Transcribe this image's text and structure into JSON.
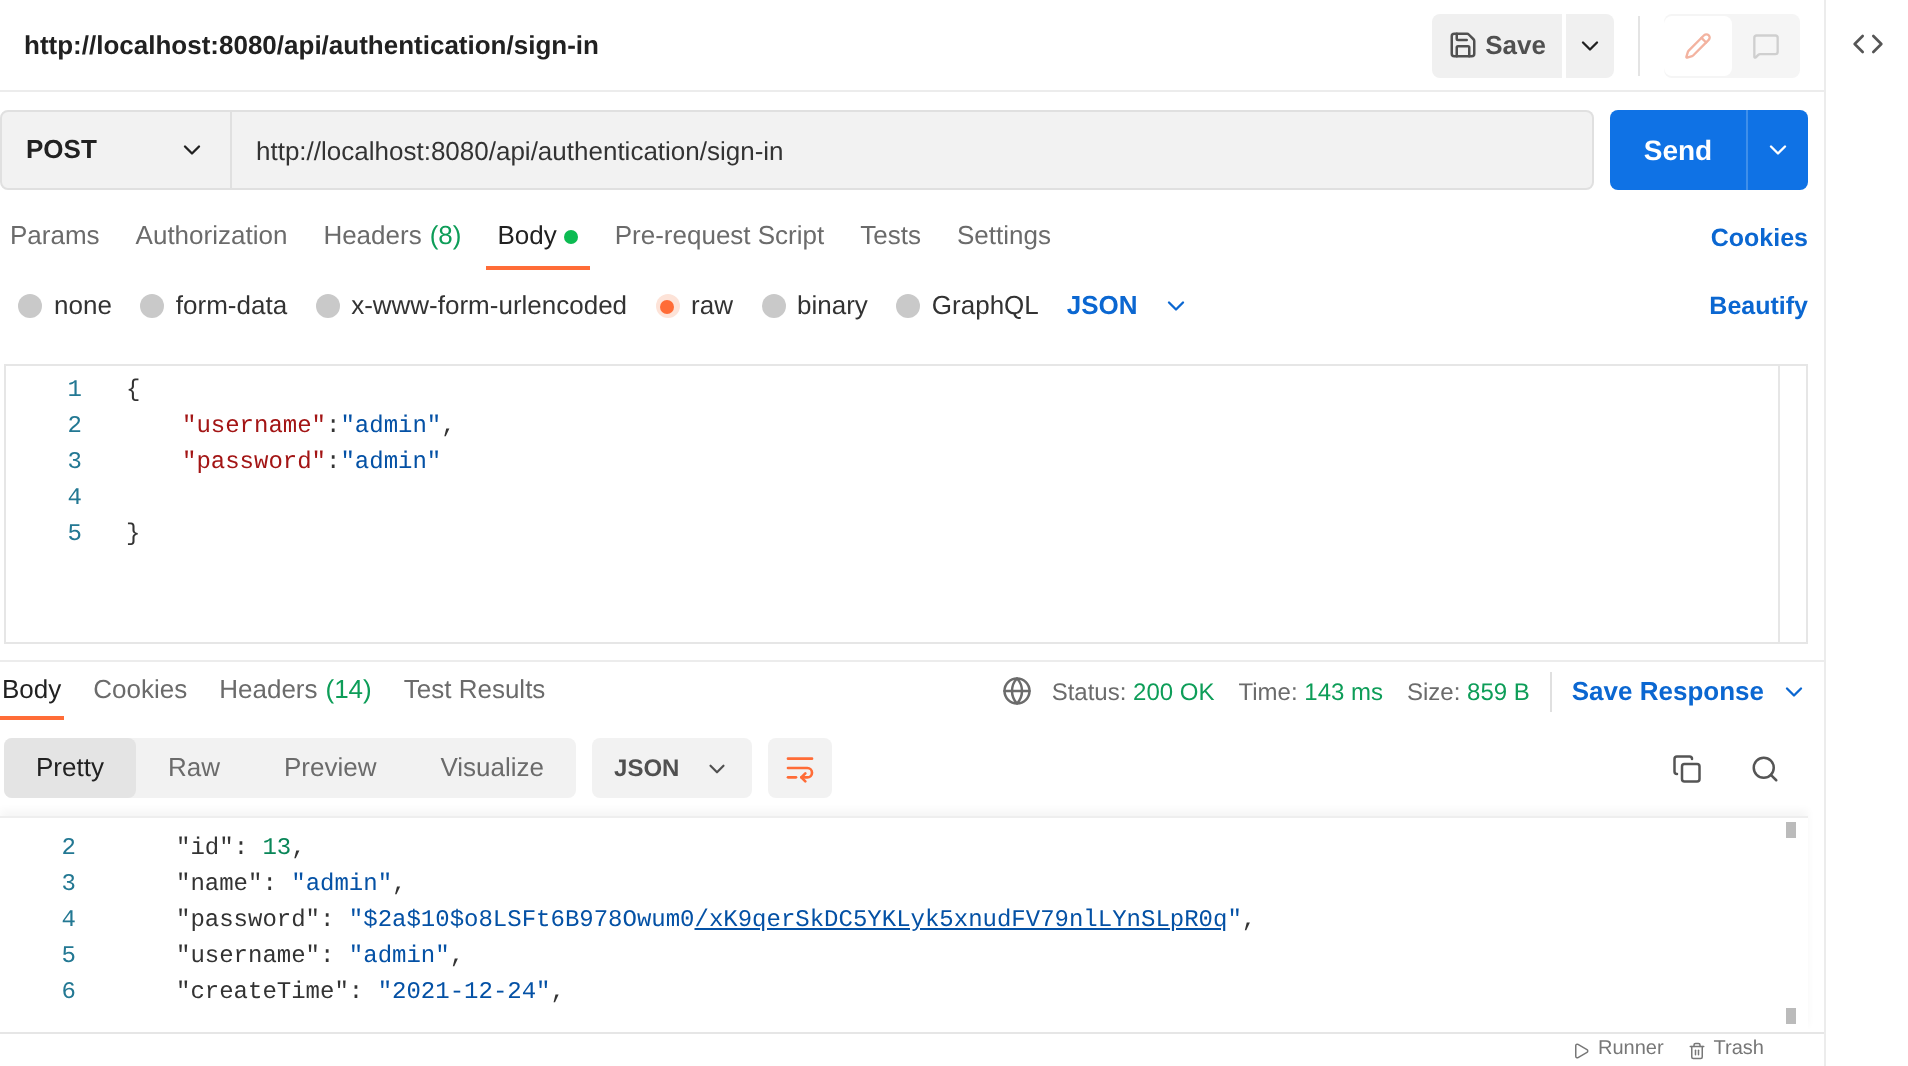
{
  "request_title": "http://localhost:8080/api/authentication/sign-in",
  "save_button": "Save",
  "method": "POST",
  "url": "http://localhost:8080/api/authentication/sign-in",
  "send_button": "Send",
  "request_tabs": [
    {
      "label": "Params",
      "selected": false,
      "dot": false
    },
    {
      "label": "Authorization",
      "selected": false,
      "dot": false
    },
    {
      "label": "Headers",
      "count": "(8)",
      "selected": false,
      "dot": false
    },
    {
      "label": "Body",
      "selected": true,
      "dot": true
    },
    {
      "label": "Pre-request Script",
      "selected": false,
      "dot": false
    },
    {
      "label": "Tests",
      "selected": false,
      "dot": false
    },
    {
      "label": "Settings",
      "selected": false,
      "dot": false
    }
  ],
  "cookies_link": "Cookies",
  "body_types": [
    {
      "label": "none",
      "selected": false
    },
    {
      "label": "form-data",
      "selected": false
    },
    {
      "label": "x-www-form-urlencoded",
      "selected": false
    },
    {
      "label": "raw",
      "selected": true
    },
    {
      "label": "binary",
      "selected": false
    },
    {
      "label": "GraphQL",
      "selected": false
    }
  ],
  "body_format": "JSON",
  "beautify_link": "Beautify",
  "request_body": [
    {
      "number": "1",
      "tokens": [
        {
          "text": "{",
          "kind": "punct"
        }
      ]
    },
    {
      "number": "2",
      "tokens": [
        {
          "text": "\"username\"",
          "kind": "key"
        },
        {
          "text": ":",
          "kind": "punct"
        },
        {
          "text": "\"admin\"",
          "kind": "string"
        },
        {
          "text": ",",
          "kind": "punct"
        }
      ]
    },
    {
      "number": "3",
      "tokens": [
        {
          "text": "\"password\"",
          "kind": "key"
        },
        {
          "text": ":",
          "kind": "punct"
        },
        {
          "text": "\"admin\"",
          "kind": "string"
        }
      ]
    },
    {
      "number": "4"
    },
    {
      "number": "5",
      "tokens": [
        {
          "text": "}",
          "kind": "punct"
        }
      ]
    }
  ],
  "response_tabs": [
    {
      "label": "Body",
      "selected": true
    },
    {
      "label": "Cookies",
      "selected": false
    },
    {
      "label": "Headers",
      "count": "(14)",
      "selected": false
    },
    {
      "label": "Test Results",
      "selected": false
    }
  ],
  "status": {
    "status_label": "Status:",
    "status_value": "200 OK",
    "time_label": "Time:",
    "time_value": "143 ms",
    "size_label": "Size:",
    "size_value": "859 B"
  },
  "save_response": "Save Response",
  "view_modes": [
    {
      "label": "Pretty",
      "selected": true
    },
    {
      "label": "Raw",
      "selected": false
    },
    {
      "label": "Preview",
      "selected": false
    },
    {
      "label": "Visualize",
      "selected": false
    }
  ],
  "response_format": "JSON",
  "response_body": [
    {
      "number": "2",
      "tokens": [
        {
          "text": "\"id\"",
          "kind": "jkey"
        },
        {
          "text": ": ",
          "kind": "punct"
        },
        {
          "text": "13",
          "kind": "number"
        },
        {
          "text": ",",
          "kind": "punct"
        }
      ]
    },
    {
      "number": "3",
      "tokens": [
        {
          "text": "\"name\"",
          "kind": "jkey"
        },
        {
          "text": ": ",
          "kind": "punct"
        },
        {
          "text": "\"admin\"",
          "kind": "string"
        },
        {
          "text": ",",
          "kind": "punct"
        }
      ]
    },
    {
      "number": "4",
      "tokens": [
        {
          "text": "\"password\"",
          "kind": "jkey"
        },
        {
          "text": ": ",
          "kind": "punct"
        },
        {
          "text": "\"$2a$10$o8LSFt6B978Owum0",
          "kind": "string"
        },
        {
          "text": "/xK9qerSkDC5YKLyk5xnudFV79nlLYnSLpR0q",
          "kind": "link"
        },
        {
          "text": "\"",
          "kind": "string"
        },
        {
          "text": ",",
          "kind": "punct"
        }
      ]
    },
    {
      "number": "5",
      "tokens": [
        {
          "text": "\"username\"",
          "kind": "jkey"
        },
        {
          "text": ": ",
          "kind": "punct"
        },
        {
          "text": "\"admin\"",
          "kind": "string"
        },
        {
          "text": ",",
          "kind": "punct"
        }
      ]
    },
    {
      "number": "6",
      "tokens": [
        {
          "text": "\"createTime\"",
          "kind": "jkey"
        },
        {
          "text": ": ",
          "kind": "punct"
        },
        {
          "text": "\"2021-12-24\"",
          "kind": "string"
        },
        {
          "text": ",",
          "kind": "punct"
        }
      ]
    }
  ],
  "footer": [
    {
      "label": "Runner"
    },
    {
      "label": "Trash"
    }
  ]
}
